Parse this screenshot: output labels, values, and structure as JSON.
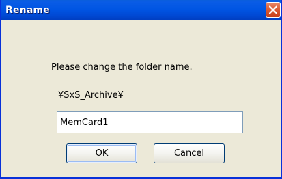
{
  "window": {
    "title": "Rename",
    "close_icon": "close-icon"
  },
  "dialog": {
    "prompt": "Please change the folder name.",
    "path": "¥SxS_Archive¥",
    "folder_name_value": "MemCard1",
    "ok_label": "OK",
    "cancel_label": "Cancel"
  },
  "colors": {
    "titlebar": "#0055e3",
    "dialog_background": "#ece9d8",
    "close_button": "#dc5c34"
  }
}
